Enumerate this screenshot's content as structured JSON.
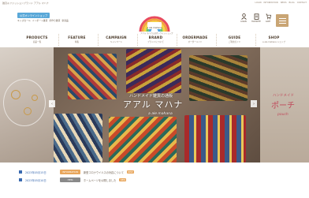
{
  "topbar": {
    "tagline": "雑貨＆ファッションブランド アアル マハナ",
    "links": [
      "LOGIN",
      "INFORMATION",
      "NEWS",
      "BLOG",
      "CONTACT"
    ]
  },
  "header": {
    "shop_badge": "公式オンラインショップ",
    "sublinks": [
      "キッズセール",
      "インポート雑貨",
      "手作り雑貨",
      "新商品"
    ],
    "logo_text": "a ale mahana",
    "logo_sub": "アアル マハナ公式オンラインショップ",
    "icons": [
      {
        "icon": "user-icon",
        "label": "LOGIN"
      },
      {
        "icon": "heart-icon",
        "label": "FAVORITE"
      },
      {
        "icon": "cart-icon",
        "label": "CART"
      }
    ]
  },
  "nav": [
    {
      "en": "PRODUCTS",
      "jp": "商品一覧"
    },
    {
      "en": "FEATURE",
      "jp": "特集"
    },
    {
      "en": "CAMPAIGN",
      "jp": "キャンペーン"
    },
    {
      "en": "BRAND",
      "jp": "ブランドについて"
    },
    {
      "en": "ORDERMADE",
      "jp": "オーダーメイド"
    },
    {
      "en": "GUIDE",
      "jp": "ご利用ガイド"
    },
    {
      "en": "SHOP",
      "jp": "a ale mahana ショップ"
    }
  ],
  "hero": {
    "caption_small": "ハンドメイド雑貨の通販",
    "caption_main": "アアル マハナ",
    "caption_script": "a ale mahana",
    "right_small": "ハンドメイド",
    "right_main": "ポーチ",
    "right_script": "pouch"
  },
  "news": [
    {
      "date": "2023年05月15日",
      "category": "INFORMATION",
      "cat_color": "#e8a65c",
      "title": "新型コロナウイルスの対応について",
      "badge": "NEW"
    },
    {
      "date": "2023年05月10日",
      "category": "ITEM",
      "cat_color": "#8a8a8a",
      "title": "ホームページを公開しました",
      "badge": "NEW"
    }
  ],
  "colors": {
    "accent": "#c9a574",
    "link_blue": "#3a6ab0",
    "badge_blue": "#5aa8d8"
  }
}
